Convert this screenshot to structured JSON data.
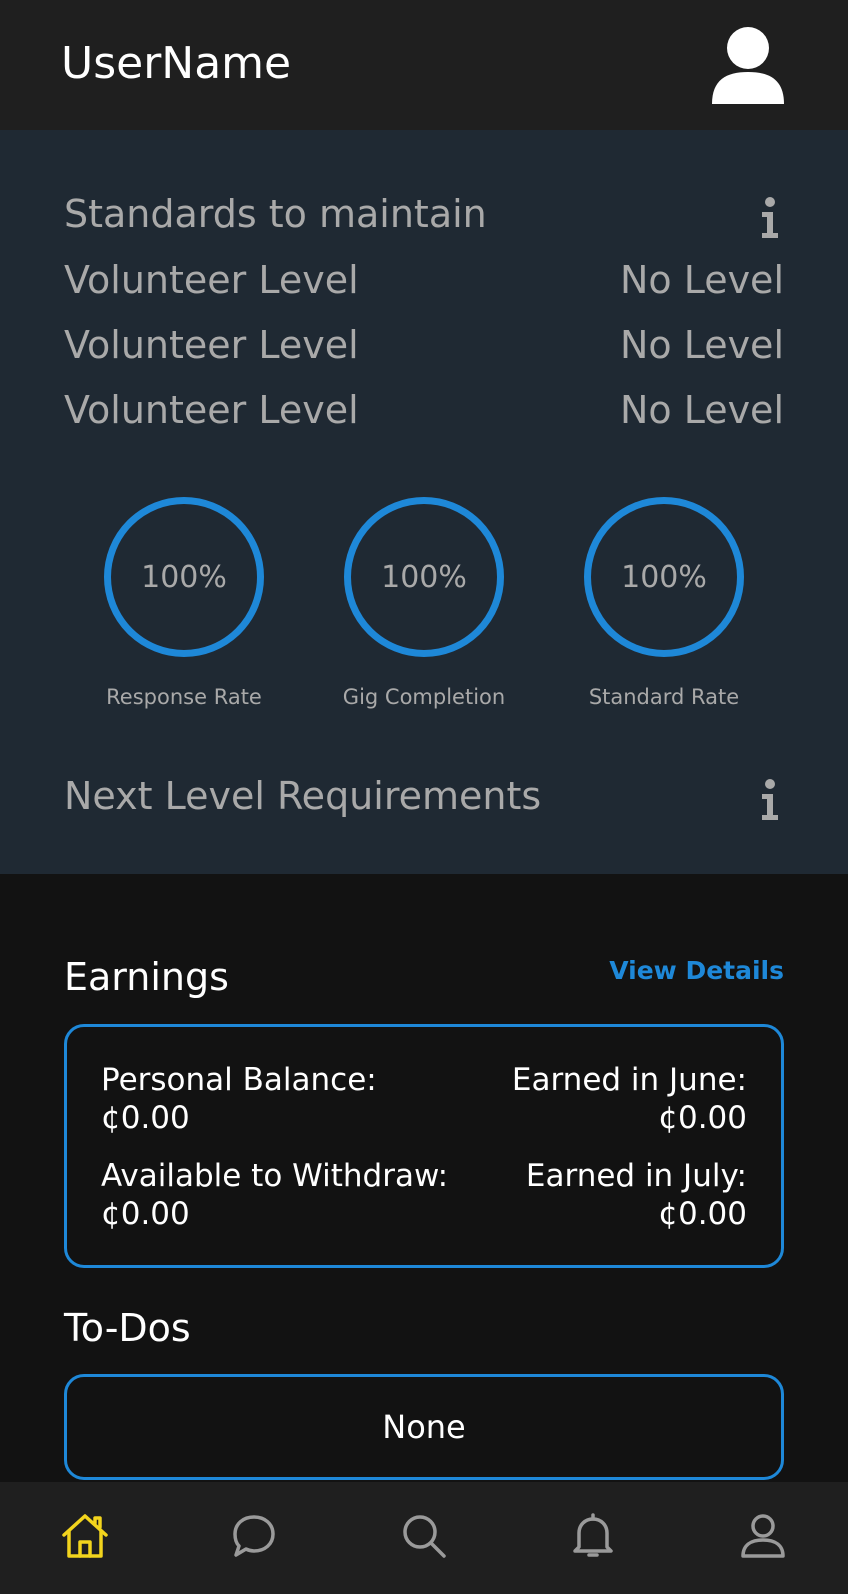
{
  "header": {
    "username": "UserName",
    "avatar_icon": "user-avatar-icon"
  },
  "standards": {
    "title": "Standards to maintain",
    "rows": [
      {
        "label": "Volunteer Level",
        "value": "No Level"
      },
      {
        "label": "Volunteer Level",
        "value": "No Level"
      },
      {
        "label": "Volunteer Level",
        "value": "No Level"
      }
    ],
    "metrics": [
      {
        "value": "100%",
        "label": "Response Rate"
      },
      {
        "value": "100%",
        "label": "Gig Completion"
      },
      {
        "value": "100%",
        "label": "Standard Rate"
      }
    ],
    "next_level_title": "Next Level Requirements"
  },
  "earnings": {
    "title": "Earnings",
    "view_details": "View Details",
    "personal_balance_label": "Personal Balance:",
    "personal_balance_value": "¢0.00",
    "available_label": "Available to Withdraw:",
    "available_value": "¢0.00",
    "june_label": "Earned in June:",
    "june_value": "¢0.00",
    "july_label": "Earned in July:",
    "july_value": "¢0.00"
  },
  "todos": {
    "title": "To-Dos",
    "value": "None"
  },
  "nav": {
    "items": [
      "home-icon",
      "chat-icon",
      "search-icon",
      "bell-icon",
      "profile-icon"
    ],
    "active_color": "#f2d41d",
    "inactive_color": "#9a9a9a"
  },
  "colors": {
    "accent": "#1e88d8",
    "panel": "#1f2933",
    "background": "#121212"
  }
}
